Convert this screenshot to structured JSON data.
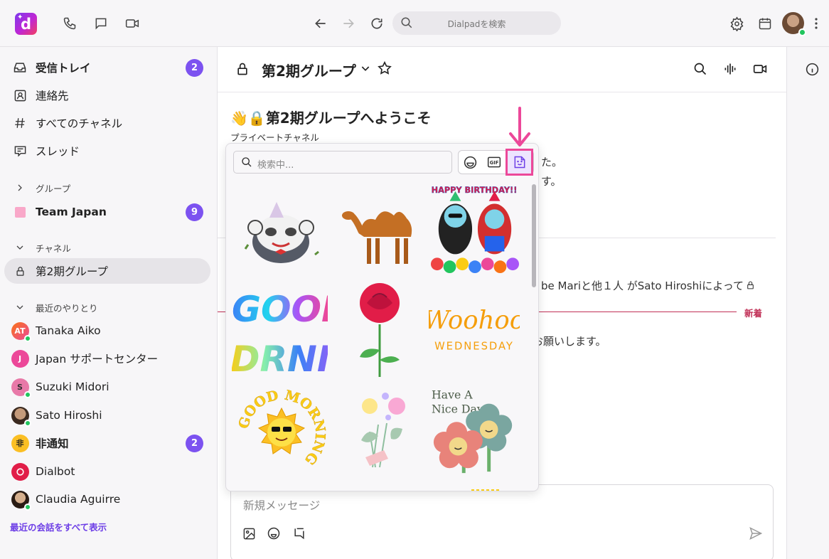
{
  "topbar": {
    "search_placeholder": "Dialpadを検索",
    "logo_letter": "d"
  },
  "sidebar": {
    "inbox": {
      "label": "受信トレイ",
      "count": "2"
    },
    "contacts": {
      "label": "連絡先"
    },
    "all_channels": {
      "label": "すべてのチャネル"
    },
    "threads": {
      "label": "スレッド"
    },
    "groups_header": "グループ",
    "team_japan": {
      "label": "Team Japan",
      "count": "9"
    },
    "channels_header": "チャネル",
    "channel_2": {
      "label": "第2期グループ"
    },
    "recent_header": "最近のやりとり",
    "recent": [
      {
        "label": "Tanaka Aiko",
        "initials": "AT"
      },
      {
        "label": "Japan サポートセンター",
        "initials": "J"
      },
      {
        "label": "Suzuki Midori",
        "initials": "S"
      },
      {
        "label": "Sato Hiroshi",
        "initials": ""
      },
      {
        "label": "非通知",
        "initials": "非",
        "count": "2"
      },
      {
        "label": "Dialbot",
        "initials": ""
      },
      {
        "label": "Claudia Aguirre",
        "initials": ""
      }
    ],
    "show_all": "最近の会話をすべて表示"
  },
  "channel": {
    "title": "第2期グループ",
    "welcome_title": "第2期グループへようこそ",
    "welcome_sub": "プライベートチャネル",
    "bg_line1": "た。",
    "bg_line2": "す。",
    "bg_line3": "be Mariと他１人 がSato Hiroshiによって",
    "new_label": "新着",
    "bg_line4": "お願いします。",
    "composer_placeholder": "新規メッセージ"
  },
  "sticker_picker": {
    "search_placeholder": "検索中...",
    "tabs": [
      "emoji",
      "gif",
      "sticker"
    ],
    "selected_tab": "sticker",
    "stickers": [
      "panda-party-sticker",
      "camel-sticker",
      "happy-birthday-penguins-sticker",
      "good-morning-rainbow-sticker",
      "rose-sticker",
      "woohoo-wednesday-sticker",
      "good-morning-sun-sticker",
      "flower-bouquet-sticker",
      "have-a-nice-day-sticker"
    ],
    "text": {
      "birthday": "HAPPY BIRTHDAY!!",
      "good_morning": "GOOD",
      "good_morning2": "DRNII",
      "woohoo": "Woohoo",
      "wednesday": "WEDNESDAY",
      "sun_text": "GOOD MORNING",
      "nice1": "Have A",
      "nice2": "Nice Day"
    }
  },
  "colors": {
    "accent": "#7c52f0",
    "highlight": "#ec4899",
    "new_line": "#c02f56"
  }
}
